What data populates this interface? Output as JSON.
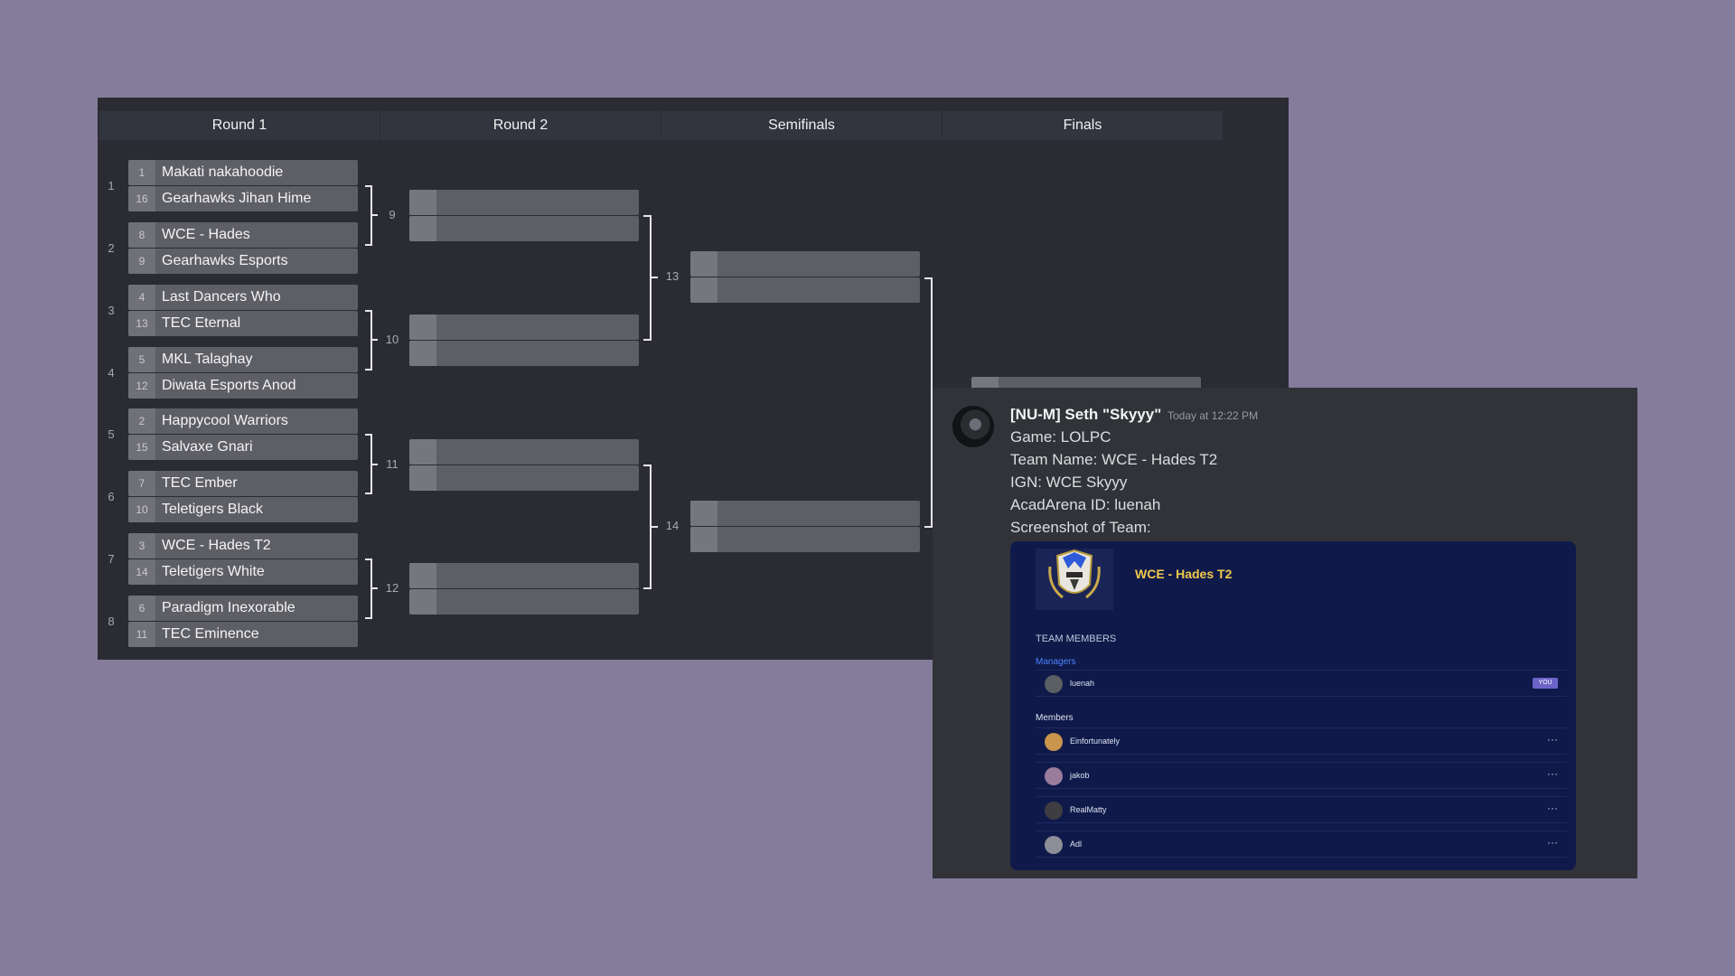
{
  "bracket": {
    "rounds": [
      "Round 1",
      "Round 2",
      "Semifinals",
      "Finals"
    ],
    "round1": [
      {
        "match": "1",
        "teams": [
          {
            "seed": "1",
            "name": "Makati nakahoodie"
          },
          {
            "seed": "16",
            "name": "Gearhawks Jihan Hime"
          }
        ]
      },
      {
        "match": "2",
        "teams": [
          {
            "seed": "8",
            "name": "WCE - Hades"
          },
          {
            "seed": "9",
            "name": "Gearhawks Esports"
          }
        ]
      },
      {
        "match": "3",
        "teams": [
          {
            "seed": "4",
            "name": "Last Dancers Who"
          },
          {
            "seed": "13",
            "name": "TEC Eternal"
          }
        ]
      },
      {
        "match": "4",
        "teams": [
          {
            "seed": "5",
            "name": "MKL Talaghay"
          },
          {
            "seed": "12",
            "name": "Diwata Esports Anod"
          }
        ]
      },
      {
        "match": "5",
        "teams": [
          {
            "seed": "2",
            "name": "Happycool Warriors"
          },
          {
            "seed": "15",
            "name": "Salvaxe Gnari"
          }
        ]
      },
      {
        "match": "6",
        "teams": [
          {
            "seed": "7",
            "name": "TEC Ember"
          },
          {
            "seed": "10",
            "name": "Teletigers Black"
          }
        ]
      },
      {
        "match": "7",
        "teams": [
          {
            "seed": "3",
            "name": "WCE - Hades T2"
          },
          {
            "seed": "14",
            "name": "Teletigers White"
          }
        ]
      },
      {
        "match": "8",
        "teams": [
          {
            "seed": "6",
            "name": "Paradigm Inexorable"
          },
          {
            "seed": "11",
            "name": "TEC Eminence"
          }
        ]
      }
    ],
    "round2_matches": [
      "9",
      "10",
      "11",
      "12"
    ],
    "semifinal_matches": [
      "13",
      "14"
    ]
  },
  "message": {
    "author": "[NU-M] Seth \"Skyyy\"",
    "timestamp": "Today at 12:22 PM",
    "lines": [
      "Game: LOLPC",
      "Team Name: WCE - Hades T2",
      "IGN: WCE Skyyy",
      "AcadArena ID: luenah",
      "Screenshot of Team:"
    ]
  },
  "team_card": {
    "team_name": "WCE - Hades T2",
    "section_label": "TEAM MEMBERS",
    "managers_label": "Managers",
    "manager": {
      "name": "luenah",
      "badge": "YOU"
    },
    "members_label": "Members",
    "members": [
      {
        "name": "Einfortunately",
        "more": "···"
      },
      {
        "name": "jakob",
        "more": "···"
      },
      {
        "name": "RealMatty",
        "more": "···"
      },
      {
        "name": "Adl",
        "more": "···"
      }
    ]
  },
  "colors": {
    "page_bg": "#857c9c",
    "bracket_bg": "#2b2c33",
    "card_bg": "#0f1a4a",
    "team_name": "#f2c94c",
    "managers": "#4c82ff"
  }
}
